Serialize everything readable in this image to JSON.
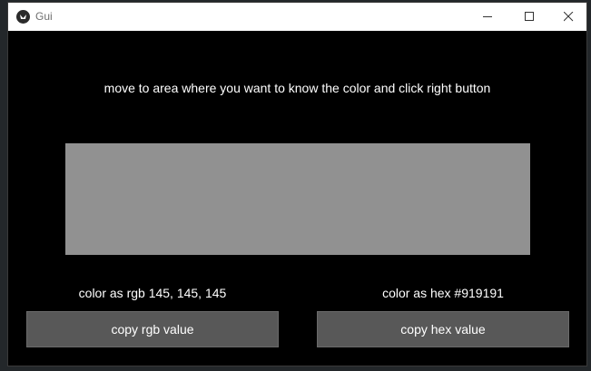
{
  "window": {
    "title": "Gui",
    "icon": "kivy-app-icon",
    "controls": {
      "minimize_icon": "minimize-icon",
      "maximize_icon": "maximize-icon",
      "close_icon": "close-icon"
    }
  },
  "main": {
    "instruction": "move to area where you want to know the color and click right button",
    "swatch_color": "#919191",
    "rgb_text": "color as rgb 145, 145, 145",
    "hex_text": "color as hex #919191",
    "copy_rgb_label": "copy rgb value",
    "copy_hex_label": "copy hex value"
  },
  "colors": {
    "background": "#000000",
    "button": "#585858",
    "text": "#ffffff"
  }
}
